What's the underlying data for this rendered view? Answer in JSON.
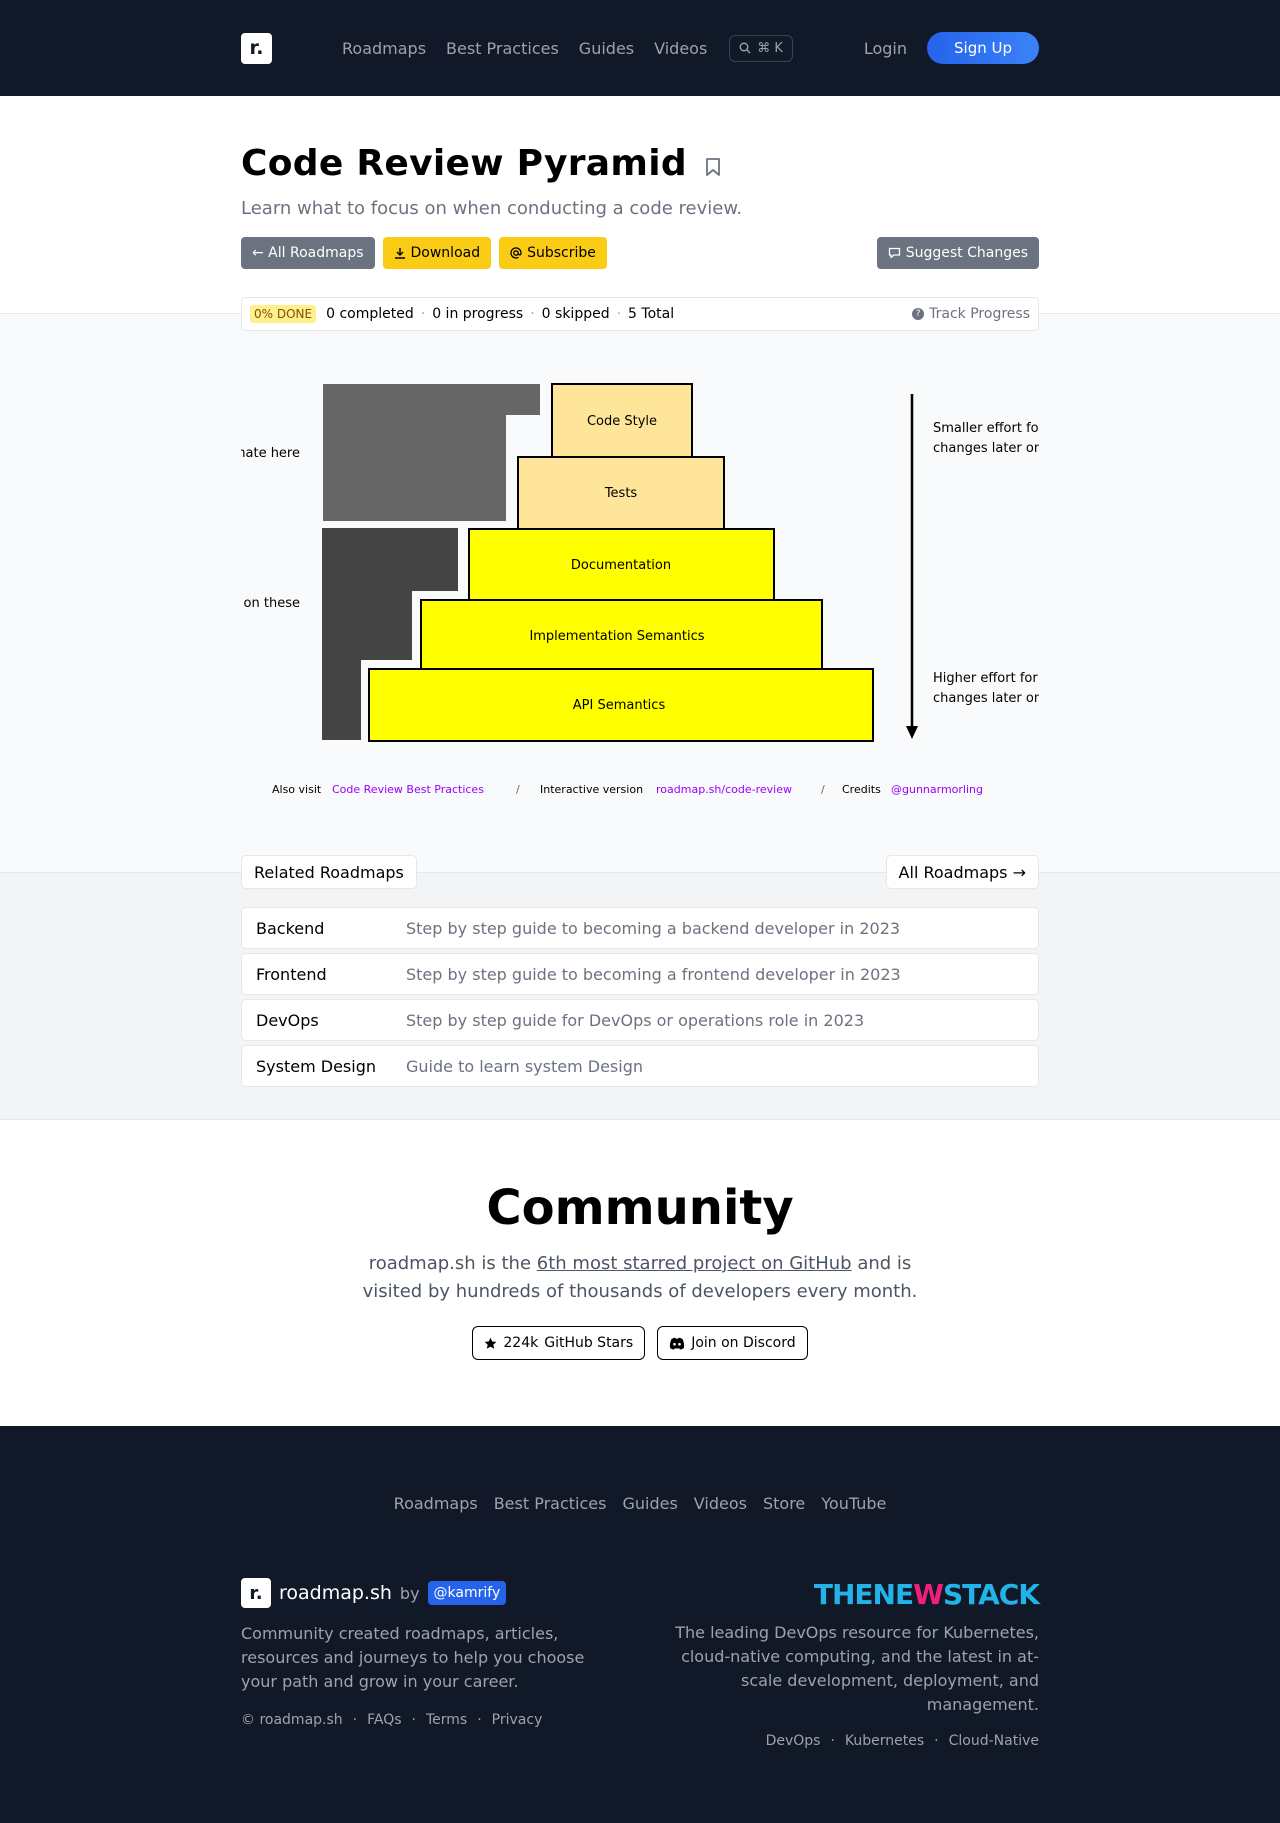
{
  "nav": {
    "links": [
      "Roadmaps",
      "Best Practices",
      "Guides",
      "Videos"
    ],
    "search_shortcut": "⌘ K",
    "login": "Login",
    "signup": "Sign Up"
  },
  "header": {
    "title": "Code Review Pyramid",
    "description": "Learn what to focus on when conducting a code review.",
    "all_roadmaps": "← All Roadmaps",
    "download": "Download",
    "subscribe": "Subscribe",
    "suggest": "Suggest Changes"
  },
  "progress": {
    "done_badge": "0% DONE",
    "completed": "0 completed",
    "in_progress": "0 in progress",
    "skipped": "0 skipped",
    "total": "5 Total",
    "track": "Track Progress"
  },
  "pyramid": {
    "levels": [
      "Code Style",
      "Tests",
      "Documentation",
      "Implementation Semantics",
      "API Semantics"
    ],
    "automate_label": "Automate here",
    "focus_label": "Focus on these",
    "smaller_effort": [
      "Smaller effort for",
      "changes later on."
    ],
    "higher_effort": [
      "Higher effort for",
      "changes later on."
    ],
    "footer": {
      "also_visit": "Also visit",
      "best_practices_link": "Code Review Best Practices",
      "interactive": "Interactive version",
      "interactive_link": "roadmap.sh/code-review",
      "credits": "Credits",
      "credits_link": "@gunnarmorling",
      "separator": "/"
    },
    "colors": {
      "automate": "#666666",
      "focus": "#444444",
      "light_level": "#ffe599",
      "bright_level": "#ffff00",
      "link": "#9900ff"
    }
  },
  "related": {
    "title": "Related Roadmaps",
    "all": "All Roadmaps →",
    "items": [
      {
        "name": "Backend",
        "desc": "Step by step guide to becoming a backend developer in 2023"
      },
      {
        "name": "Frontend",
        "desc": "Step by step guide to becoming a frontend developer in 2023"
      },
      {
        "name": "DevOps",
        "desc": "Step by step guide for DevOps or operations role in 2023"
      },
      {
        "name": "System Design",
        "desc": "Guide to learn system Design"
      }
    ]
  },
  "community": {
    "title": "Community",
    "line1_pre": "roadmap.sh is the ",
    "line1_link": "6th most starred project on GitHub",
    "line1_post": " and is",
    "line2": "visited by hundreds of thousands of developers every month.",
    "stars_count": "224k",
    "stars_label": "GitHub Stars",
    "discord": "Join on Discord"
  },
  "footer": {
    "links": [
      "Roadmaps",
      "Best Practices",
      "Guides",
      "Videos",
      "Store",
      "YouTube"
    ],
    "brand": "roadmap.sh",
    "by": "by",
    "author": "@kamrify",
    "about": "Community created roadmaps, articles, resources and journeys to help you choose your path and grow in your career.",
    "legal": [
      "© roadmap.sh",
      "FAQs",
      "Terms",
      "Privacy"
    ],
    "sponsor_part1": "THENE",
    "sponsor_part2": "W",
    "sponsor_part3": "STACK",
    "sponsor_desc": "The leading DevOps resource for Kubernetes, cloud-native computing, and the latest in at-scale development, deployment, and management.",
    "sponsor_links": [
      "DevOps",
      "Kubernetes",
      "Cloud-Native"
    ],
    "dot": "·"
  }
}
